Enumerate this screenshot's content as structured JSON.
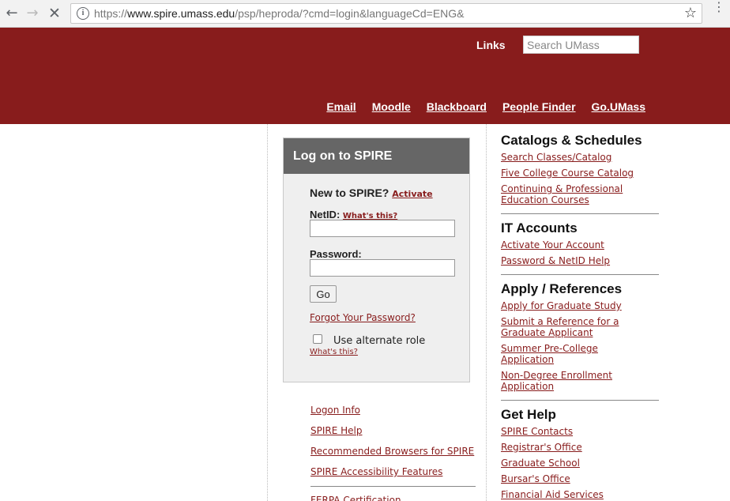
{
  "browser": {
    "url_scheme": "https://",
    "url_host": "www.spire.umass.edu",
    "url_path": "/psp/heproda/?cmd=login&languageCd=ENG&"
  },
  "header": {
    "links_label": "Links",
    "search_placeholder": "Search UMass",
    "nav": [
      "Email",
      "Moodle",
      "Blackboard",
      "People Finder",
      "Go.UMass"
    ]
  },
  "login": {
    "title": "Log on to SPIRE",
    "new_to": "New to SPIRE?",
    "activate": "Activate",
    "netid_label": "NetID:",
    "whats_this": "What's this?",
    "password_label": "Password:",
    "go": "Go",
    "forgot": "Forgot Your Password?",
    "alt_role": "Use alternate role",
    "alt_whats_this": "What's this?"
  },
  "lower_links": [
    "Logon Info",
    "SPIRE Help",
    "Recommended Browsers for SPIRE",
    "SPIRE Accessibility Features"
  ],
  "ferpa": "FERPA Certification",
  "sections": [
    {
      "title": "Catalogs & Schedules",
      "links": [
        "Search Classes/Catalog",
        "Five College Course Catalog",
        "Continuing & Professional Education Courses"
      ]
    },
    {
      "title": "IT Accounts",
      "links": [
        "Activate Your Account",
        "Password & NetID Help"
      ]
    },
    {
      "title": "Apply / References",
      "links": [
        "Apply for Graduate Study",
        "Submit a Reference for a Graduate Applicant",
        "Summer Pre-College Application",
        "Non-Degree Enrollment Application"
      ]
    },
    {
      "title": "Get Help",
      "links": [
        "SPIRE Contacts",
        "Registrar's Office",
        "Graduate School",
        "Bursar's Office",
        "Financial Aid Services"
      ]
    }
  ],
  "colors": {
    "brand": "#881c1c",
    "login_header": "#666666"
  }
}
